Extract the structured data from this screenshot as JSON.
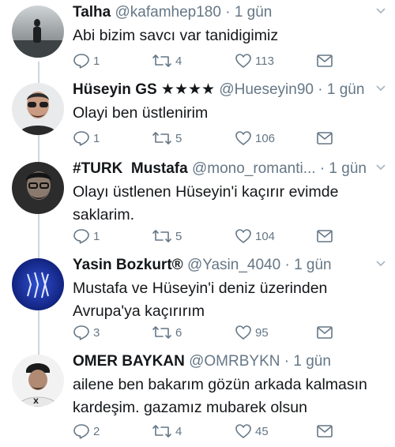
{
  "tweets": [
    {
      "name": "Talha",
      "handle": "@kafamhep180",
      "time": "· 1 gün",
      "text": "Abi bizim savcı var tanidigimiz",
      "replies": "1",
      "retweets": "4",
      "likes": "113",
      "avatar": "dark-silhouette"
    },
    {
      "name": "Hüseyin GS ★★★★",
      "handle": "@Hueseyin90",
      "time": "· 1 gün",
      "text": "Olayi ben üstlenirim",
      "replies": "1",
      "retweets": "5",
      "likes": "106",
      "avatar": "man-sunglasses"
    },
    {
      "name": "#TURK  Mustafa",
      "handle": "@mono_romanti...",
      "time": "· 1 gün",
      "text": "Olayı üstlenen Hüseyin'i kaçırır evimde saklarim.",
      "replies": "1",
      "retweets": "5",
      "likes": "104",
      "avatar": "man-glasses"
    },
    {
      "name": "Yasin Bozkurt®",
      "handle": "@Yasin_4040",
      "time": "· 1 gün",
      "text": "Mustafa ve Hüseyin'i deniz üzerinden Avrupa'ya kaçırırım",
      "replies": "3",
      "retweets": "6",
      "likes": "95",
      "avatar": "blue-logo"
    },
    {
      "name": "OMER BAYKAN",
      "handle": "@OMRBYKN",
      "time": "· 1 gün",
      "text": "ailene ben bakarım gözün arkada kalmasın kardeşim. gazamız mubarek olsun",
      "replies": "2",
      "retweets": "4",
      "likes": "45",
      "avatar": "man-cap"
    }
  ],
  "colors": {
    "text": "#14171a",
    "secondary": "#657786",
    "thread": "#ccd6dd",
    "divider": "#e1e8ed"
  }
}
